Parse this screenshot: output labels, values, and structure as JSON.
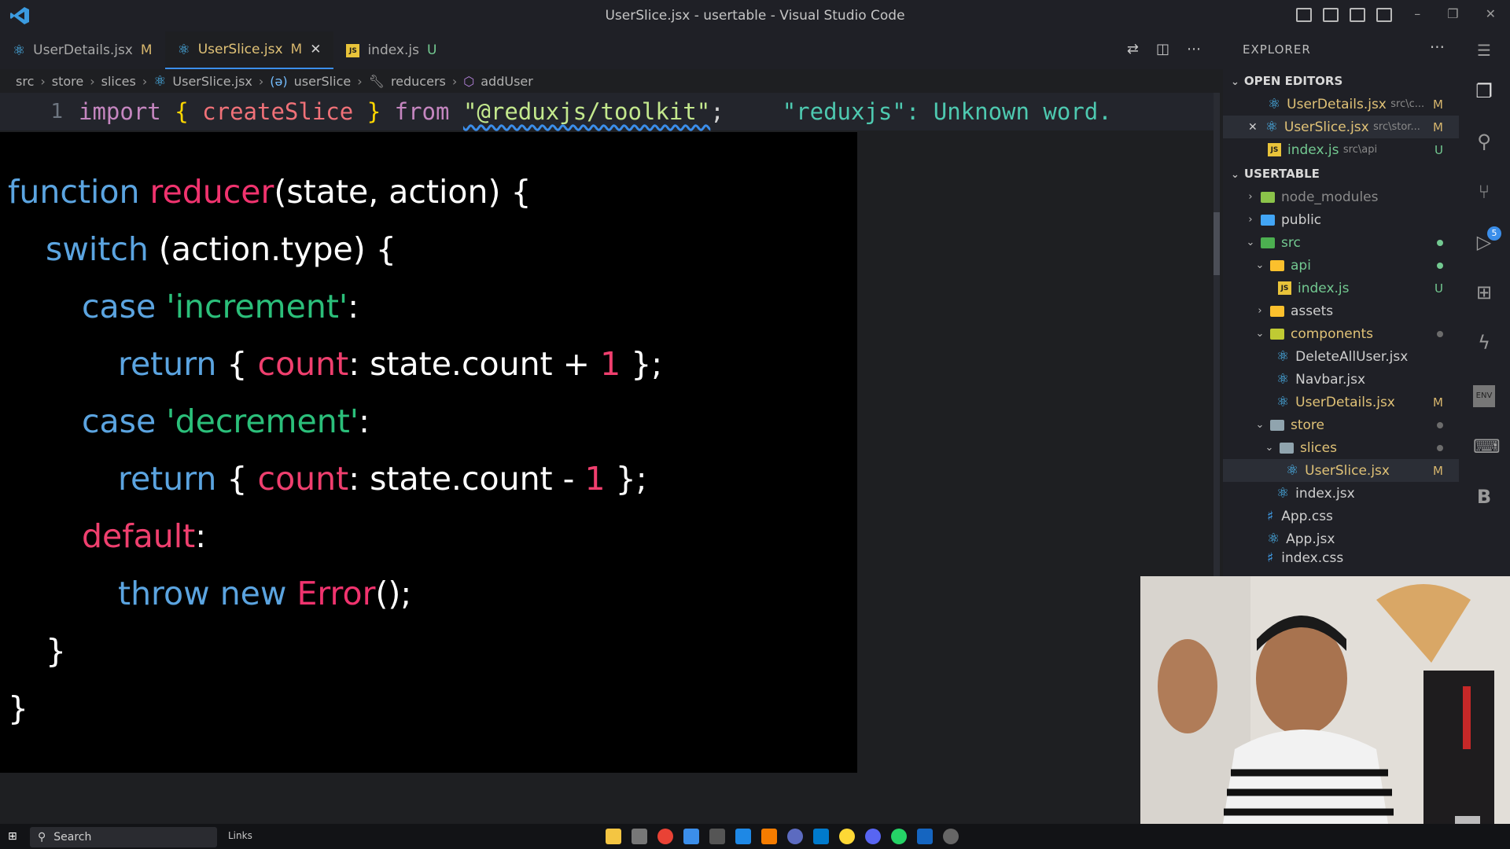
{
  "window": {
    "title": "UserSlice.jsx - usertable - Visual Studio Code"
  },
  "tabs": [
    {
      "label": "UserDetails.jsx",
      "status": "M",
      "icon": "react-icon"
    },
    {
      "label": "UserSlice.jsx",
      "status": "M",
      "icon": "react-icon",
      "close": "✕"
    },
    {
      "label": "index.js",
      "status": "U",
      "icon": "js-icon",
      "js": "JS"
    }
  ],
  "breadcrumb": [
    "src",
    "store",
    "slices",
    "UserSlice.jsx",
    "userSlice",
    "reducers",
    "addUser"
  ],
  "editor": {
    "line1_number": "1",
    "line1_import": "import",
    "line1_open": "{",
    "line1_name": "createSlice",
    "line1_close": "}",
    "line1_from": "from",
    "line1_string": "\"@reduxjs/toolkit\"",
    "line1_semi": ";",
    "diagnostic": "\"reduxjs\": Unknown word."
  },
  "overlay_code": {
    "l1_kw": "function",
    "l1_fn": "reducer",
    "l1_rest": "(state, action) {",
    "l2_kw": "switch",
    "l2_rest": " (action.type) {",
    "l3_kw": "case",
    "l3_str": "'increment'",
    "l3_rest": ":",
    "l4_kw": "return",
    "l4_a": " { ",
    "l4_key": "count",
    "l4_b": ": state.count + ",
    "l4_num": "1",
    "l4_c": " };",
    "l5_kw": "case",
    "l5_str": "'decrement'",
    "l5_rest": ":",
    "l6_kw": "return",
    "l6_a": " { ",
    "l6_key": "count",
    "l6_b": ": state.count - ",
    "l6_num": "1",
    "l6_c": " };",
    "l7_kw": "default",
    "l7_rest": ":",
    "l8_kw1": "throw",
    "l8_kw2": "new",
    "l8_cls": "Error",
    "l8_rest": "();",
    "l9": "}",
    "l10": "}"
  },
  "explorer": {
    "header": "EXPLORER",
    "more": "···",
    "open_editors_label": "OPEN EDITORS",
    "open_editors": [
      {
        "name": "UserDetails.jsx",
        "path": "src\\c...",
        "status": "M"
      },
      {
        "name": "UserSlice.jsx",
        "path": "src\\stor...",
        "status": "M",
        "close": "✕"
      },
      {
        "name": "index.js",
        "path": "src\\api",
        "status": "U"
      }
    ],
    "project_label": "USERTABLE",
    "tree": [
      {
        "name": "node_modules"
      },
      {
        "name": "public"
      },
      {
        "name": "src"
      },
      {
        "name": "api"
      },
      {
        "name": "index.js",
        "status": "U"
      },
      {
        "name": "assets"
      },
      {
        "name": "components"
      },
      {
        "name": "DeleteAllUser.jsx"
      },
      {
        "name": "Navbar.jsx"
      },
      {
        "name": "UserDetails.jsx",
        "status": "M"
      },
      {
        "name": "store"
      },
      {
        "name": "slices"
      },
      {
        "name": "UserSlice.jsx",
        "status": "M"
      },
      {
        "name": "index.jsx"
      },
      {
        "name": "App.css"
      },
      {
        "name": "App.jsx"
      },
      {
        "name": "index.css"
      }
    ]
  },
  "activity": {
    "source_control_badge": "5"
  },
  "taskbar": {
    "search_label": "Search",
    "links_label": "Links"
  },
  "colors": {
    "accent": "#3b8eea",
    "modified": "#d7b66d",
    "untracked": "#73c991"
  }
}
